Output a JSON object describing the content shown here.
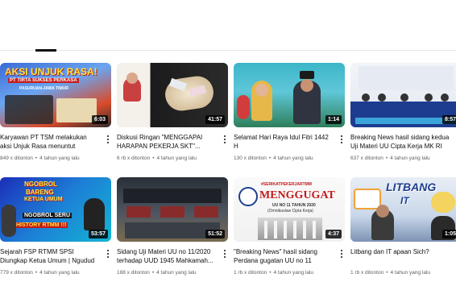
{
  "colors": {
    "text": "#0f0f0f",
    "meta": "#606060",
    "background": "#ffffff"
  },
  "videos": [
    {
      "thumb_text_1": "AKSI UNJUK RASA!",
      "thumb_text_2": "PT TIRTA SUKSES PERKASA",
      "thumb_text_3": "PASURUAN-JAWA TIMUR",
      "duration": "6:03",
      "title": "Karyawan PT TSM melakukan aksi Unjuk Rasa menuntut pemenuhan...",
      "views": "849 x ditonton",
      "age": "4 tahun yang lalu"
    },
    {
      "duration": "41:57",
      "title": "Diskusi Ringan \"MENGGAPAI HARAPAN PEKERJA SKT\"...",
      "views": "6 rb x ditonton",
      "age": "4 tahun yang lalu"
    },
    {
      "duration": "1:14",
      "title": "Selamat Hari Raya Idul Fitri 1442 H",
      "views": "130 x ditonton",
      "age": "4 tahun yang lalu"
    },
    {
      "duration": "8:57",
      "title": "Breaking News hasil sidang kedua Uji Materi UU Cipta Kerja MK RI ole...",
      "views": "637 x ditonton",
      "age": "4 tahun yang lalu"
    },
    {
      "thumb_text_1": "NGOBROL",
      "thumb_text_2": "BARENG",
      "thumb_text_3": "KETUA UMUM",
      "thumb_text_4": "NGOBROL SERU",
      "thumb_text_5": "HISTORY RTMM !!!",
      "duration": "53:57",
      "title": "Sejarah FSP RTMM SPSI Diungkap Ketua Umum | Ngudud bareng...",
      "views": "779 x ditonton",
      "age": "4 tahun yang lalu"
    },
    {
      "duration": "51:52",
      "title": "Sidang Uji Materi UU no 11/2020 terhadap UUD 1945 Mahkamah...",
      "views": "188 x ditonton",
      "age": "4 tahun yang lalu"
    },
    {
      "thumb_text_1": "#SERIKATPEKERJARTMM",
      "thumb_text_2": "MENGGUGAT",
      "thumb_text_3": "UU NO 11 TAHUN 2020",
      "thumb_text_4": "(Omnibuslaw Cipta Kerja)",
      "duration": "4:37",
      "title": "\"Breaking News\" hasil sidang Perdana gugatan UU no 11 tahun...",
      "views": "1 rb x ditonton",
      "age": "4 tahun yang lalu"
    },
    {
      "thumb_text_1": "LITBANG",
      "thumb_text_2": "IT",
      "duration": "1:05",
      "title": "Litbang dan IT apaan Sich?",
      "views": "1 rb x ditonton",
      "age": "4 tahun yang lalu"
    }
  ]
}
